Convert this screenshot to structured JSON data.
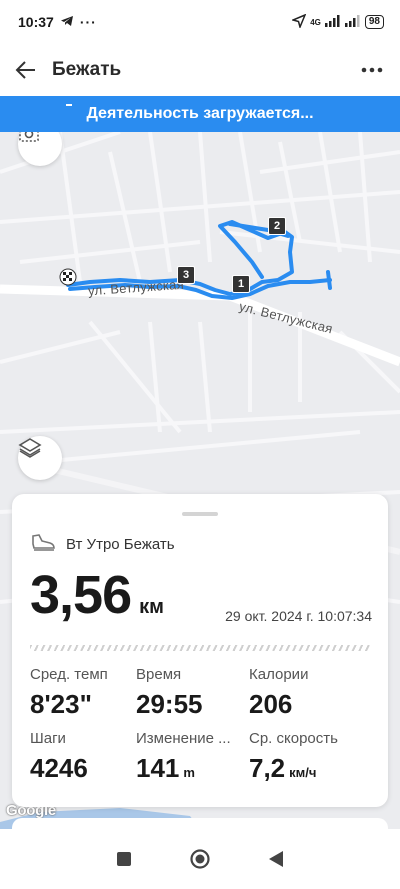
{
  "status_bar": {
    "time": "10:37",
    "network": "4G",
    "battery": "98"
  },
  "app_bar": {
    "title": "Бежать"
  },
  "banner": {
    "text": "Деятельность загружается..."
  },
  "map": {
    "street_label_1": "ул. Ветлужская",
    "street_label_2": "ул. Ветлужская",
    "markers": [
      "1",
      "2",
      "3"
    ],
    "attribution": "Google",
    "route_color": "#2a8cf0"
  },
  "activity": {
    "name": "Вт Утро Бежать",
    "distance": "3,56",
    "distance_unit": "км",
    "datetime": "29 окт. 2024 г. 10:07:34"
  },
  "stats": [
    {
      "label": "Сред. темп",
      "value": "8'23\"",
      "unit": ""
    },
    {
      "label": "Время",
      "value": "29:55",
      "unit": ""
    },
    {
      "label": "Калории",
      "value": "206",
      "unit": ""
    },
    {
      "label": "Шаги",
      "value": "4246",
      "unit": ""
    },
    {
      "label": "Изменение ...",
      "value": "141",
      "unit": "m"
    },
    {
      "label": "Ср. скорость",
      "value": "7,2",
      "unit": "км/ч"
    }
  ],
  "colors": {
    "accent": "#2a8cf0",
    "map_bg": "#ebecef"
  }
}
